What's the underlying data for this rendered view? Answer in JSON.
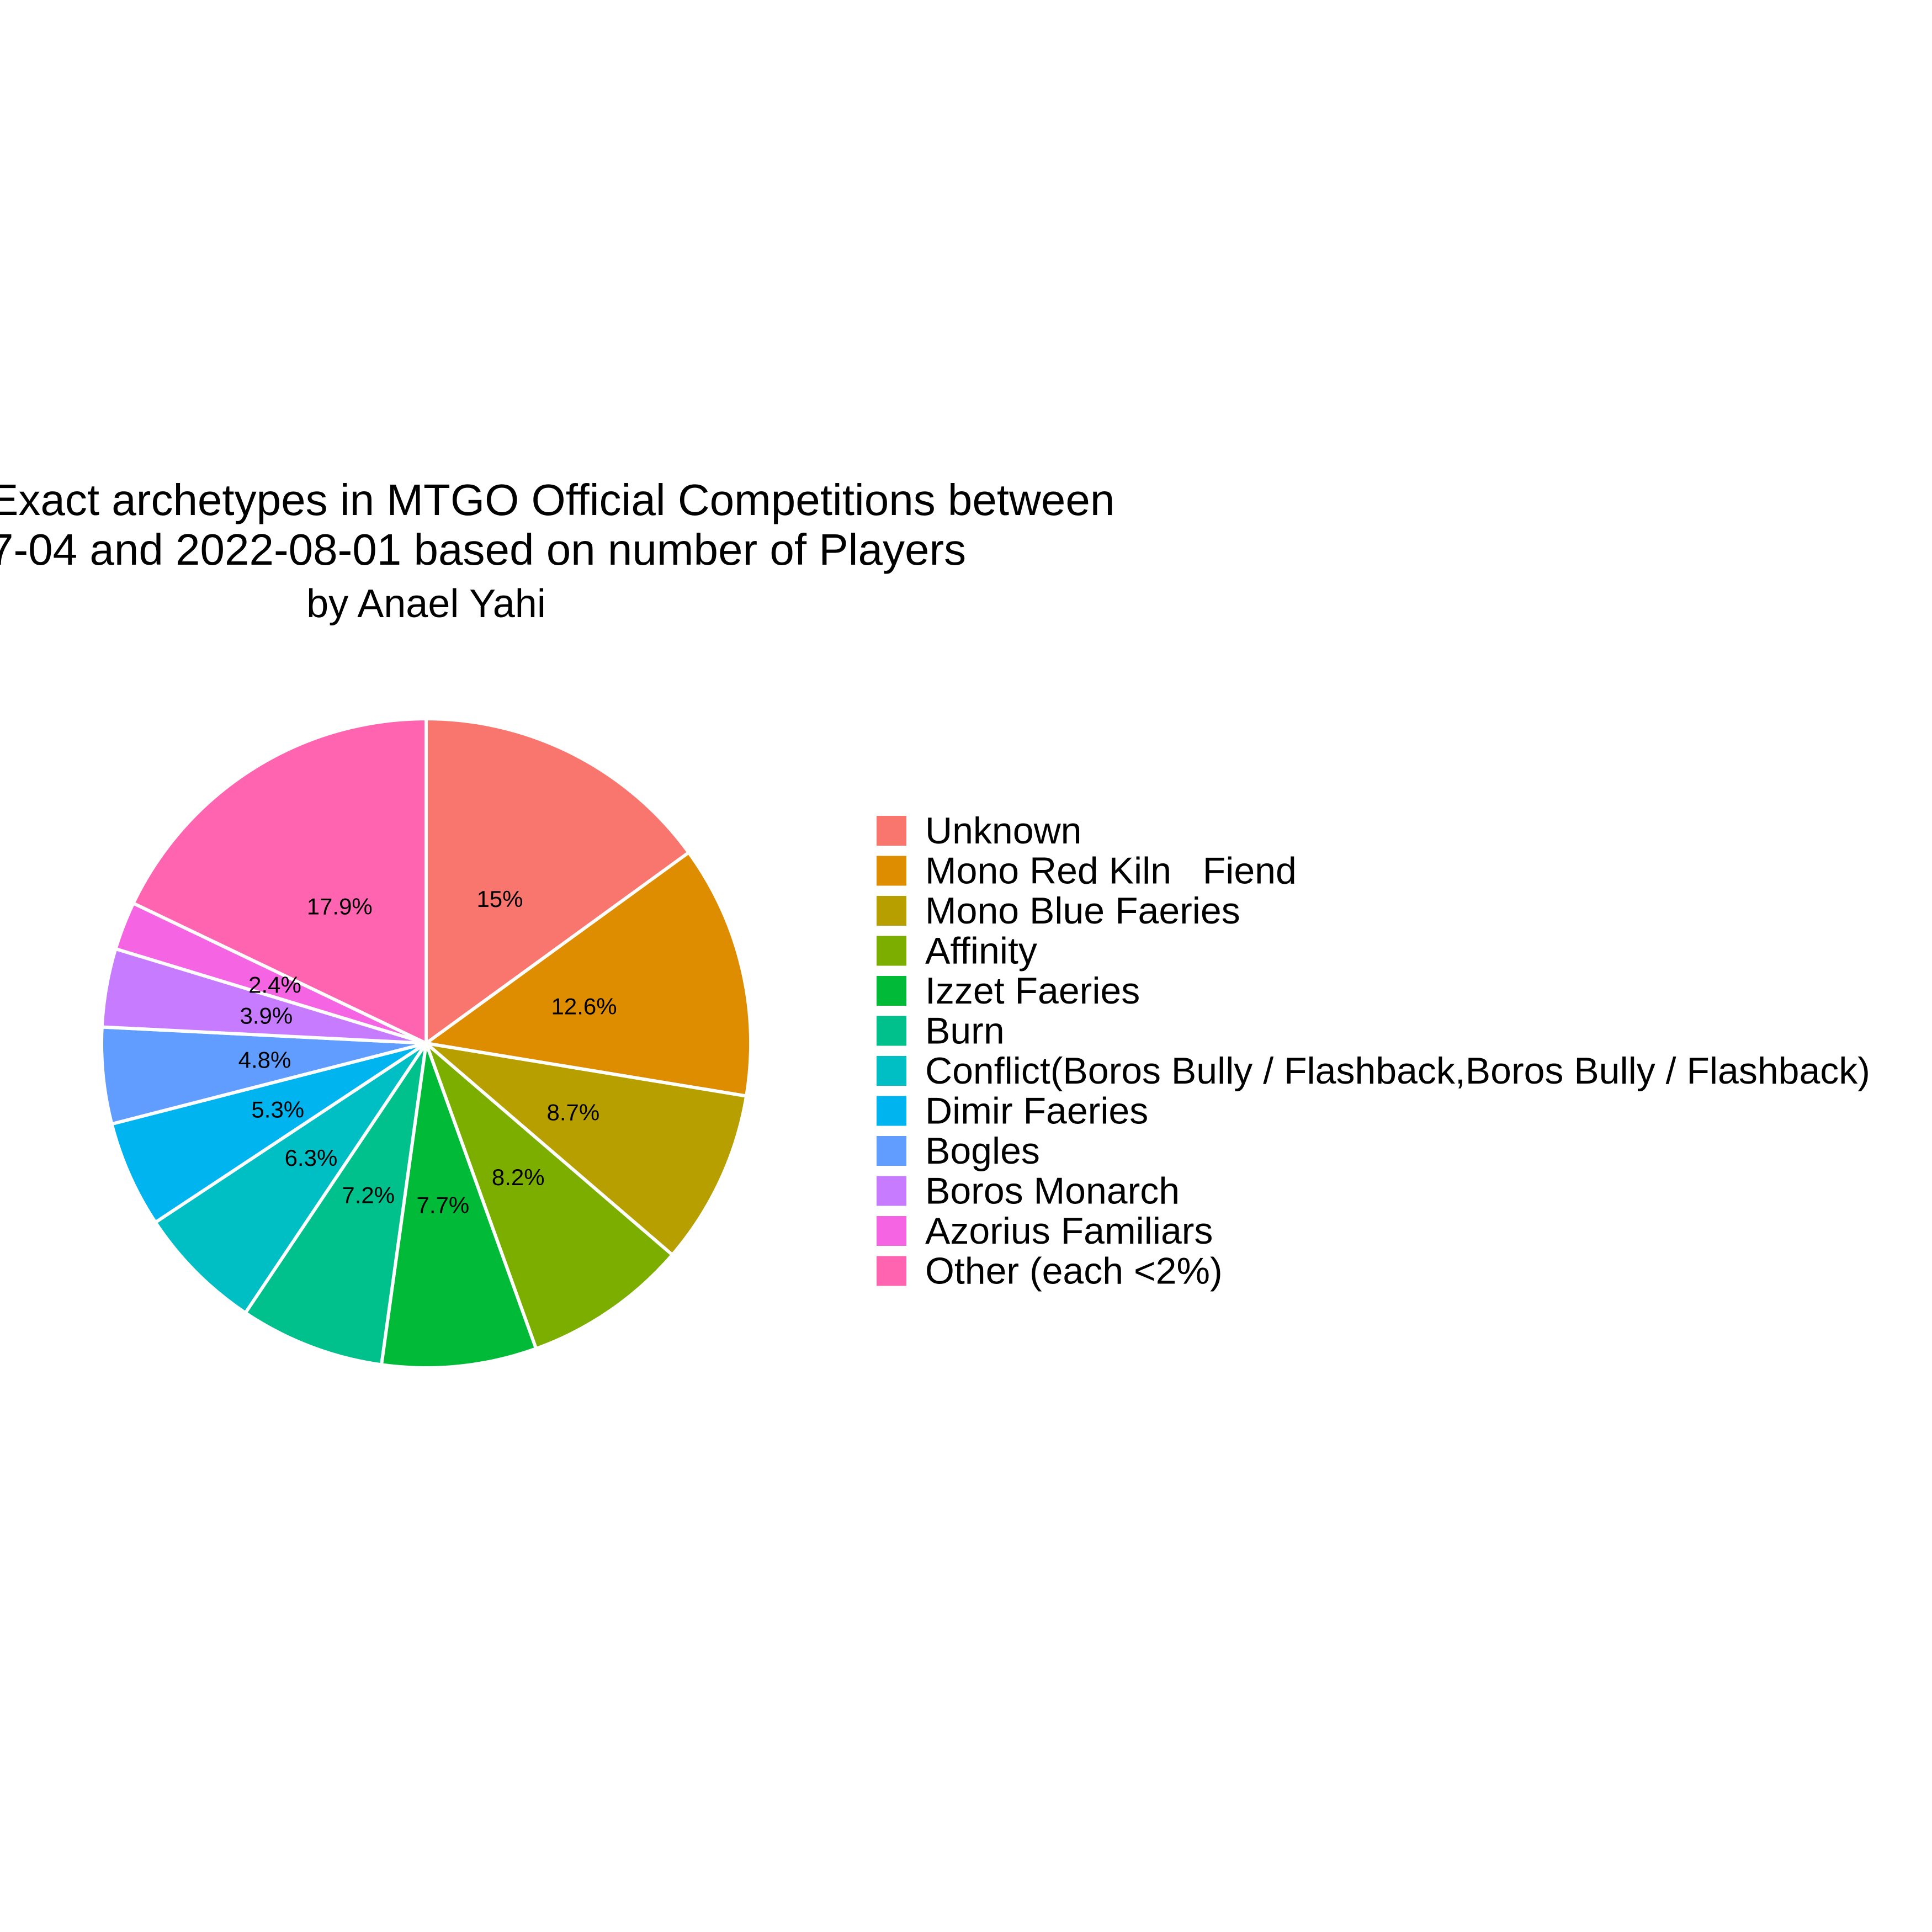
{
  "chart_data": {
    "type": "pie",
    "title_lines": [
      "Exact archetypes in MTGO Official Competitions between",
      "7-04 and 2022-08-01 based on number of Players"
    ],
    "subtitle": "by Anael Yahi",
    "slices": [
      {
        "name": "Unknown",
        "value": 15.0,
        "label": "15%",
        "color": "#F8766D"
      },
      {
        "name": "Mono Red Kiln   Fiend",
        "value": 12.6,
        "label": "12.6%",
        "color": "#DE8C00"
      },
      {
        "name": "Mono Blue Faeries",
        "value": 8.7,
        "label": "8.7%",
        "color": "#B79F00"
      },
      {
        "name": "Affinity",
        "value": 8.2,
        "label": "8.2%",
        "color": "#7CAE00"
      },
      {
        "name": "Izzet Faeries",
        "value": 7.7,
        "label": "7.7%",
        "color": "#00BA38"
      },
      {
        "name": "Burn",
        "value": 7.2,
        "label": "7.2%",
        "color": "#00C08B"
      },
      {
        "name": "Conflict(Boros Bully / Flashback,Boros Bully / Flashback)",
        "value": 6.3,
        "label": "6.3%",
        "color": "#00BFC4"
      },
      {
        "name": "Dimir Faeries",
        "value": 5.3,
        "label": "5.3%",
        "color": "#00B4F0"
      },
      {
        "name": "Bogles",
        "value": 4.8,
        "label": "4.8%",
        "color": "#619CFF"
      },
      {
        "name": "Boros Monarch",
        "value": 3.9,
        "label": "3.9%",
        "color": "#C77CFF"
      },
      {
        "name": "Azorius Familiars",
        "value": 2.4,
        "label": "2.4%",
        "color": "#F564E3"
      },
      {
        "name": "Other (each <2%)",
        "value": 17.9,
        "label": "17.9%",
        "color": "#FF64B0"
      }
    ],
    "legend_position": "right",
    "slice_border_color": "#ffffff"
  }
}
